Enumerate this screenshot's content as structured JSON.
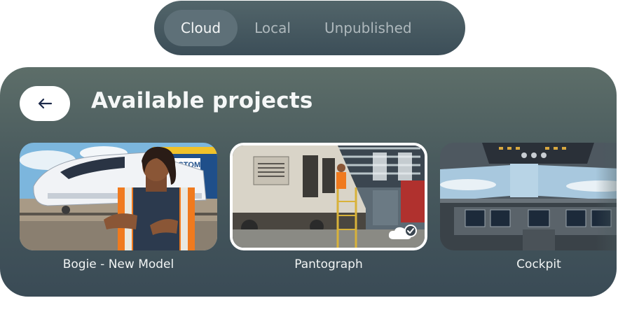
{
  "tabs": [
    {
      "label": "Cloud",
      "active": true
    },
    {
      "label": "Local",
      "active": false
    },
    {
      "label": "Unpublished",
      "active": false
    }
  ],
  "panel": {
    "back_icon": "arrow-left-icon",
    "title": "Available projects"
  },
  "projects": [
    {
      "label": "Bogie - New Model",
      "selected": false,
      "image": "train-worker-illustration",
      "badge": null
    },
    {
      "label": "Pantograph",
      "selected": true,
      "image": "train-depot-illustration",
      "badge": "cloud-synced-check-icon"
    },
    {
      "label": "Cockpit",
      "selected": false,
      "image": "aircraft-cockpit-illustration",
      "badge": null
    }
  ],
  "colors": {
    "panel": "#4a5b5e",
    "tabs_bg": "#46575f",
    "active_tab": "#5e7078",
    "accent_navy": "#1d2a4a",
    "vest_orange": "#f07a1e"
  }
}
